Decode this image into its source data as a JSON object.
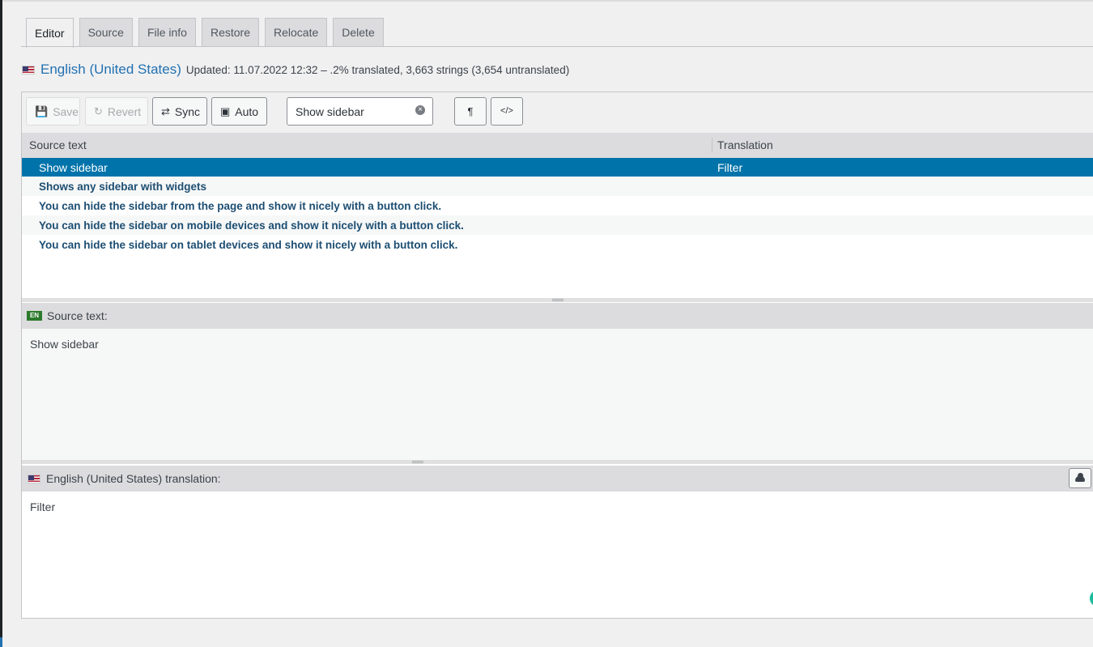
{
  "tabs": [
    {
      "label": "Editor",
      "active": true
    },
    {
      "label": "Source",
      "active": false
    },
    {
      "label": "File info",
      "active": false
    },
    {
      "label": "Restore",
      "active": false
    },
    {
      "label": "Relocate",
      "active": false
    },
    {
      "label": "Delete",
      "active": false
    }
  ],
  "header": {
    "locale_name": "English (United States)",
    "meta": "Updated: 11.07.2022 12:32 – .2% translated, 3,663 strings (3,654 untranslated)"
  },
  "toolbar": {
    "save_label": "Save",
    "revert_label": "Revert",
    "sync_label": "Sync",
    "auto_label": "Auto",
    "filter_value": "Show sidebar",
    "pilcrow_glyph": "¶",
    "code_glyph": "</>"
  },
  "grid": {
    "col_source": "Source text",
    "col_translation": "Translation",
    "rows": [
      {
        "source": "Show sidebar",
        "translation": "Filter",
        "selected": true
      },
      {
        "source": "Shows any sidebar with widgets",
        "translation": ""
      },
      {
        "source": "You can hide the sidebar from the page and show it nicely with a button click.",
        "translation": ""
      },
      {
        "source": "You can hide the sidebar on mobile devices and show it nicely with a button click.",
        "translation": ""
      },
      {
        "source": "You can hide the sidebar on tablet devices and show it nicely with a button click.",
        "translation": ""
      }
    ]
  },
  "source_panel": {
    "badge": "EN",
    "title": "Source text:",
    "text": "Show sidebar"
  },
  "translation_panel": {
    "title": "English (United States) translation:",
    "text": "Filter"
  },
  "colors": {
    "accent": "#2271b1",
    "selected_row": "#0073aa",
    "en_badge": "#2c7a2c"
  },
  "icons": [
    "save-icon",
    "revert-icon",
    "sync-icon",
    "robot-icon",
    "clear-icon",
    "pilcrow-icon",
    "code-icon",
    "cloud-icon",
    "us-flag-icon"
  ]
}
